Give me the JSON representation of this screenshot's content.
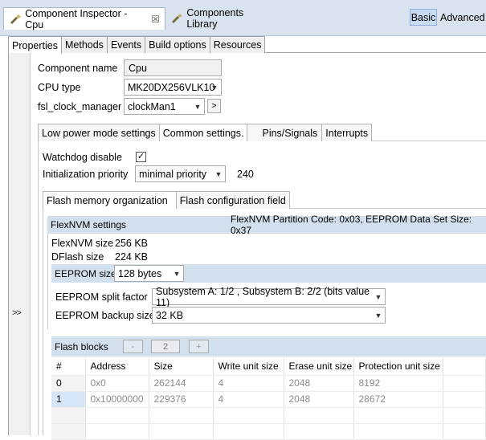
{
  "view_tabs": {
    "inspector_label": "Component Inspector - Cpu",
    "inspector_close": "☒",
    "library_label": "Components Library"
  },
  "mode": {
    "basic": "Basic",
    "advanced": "Advanced"
  },
  "main_tabs": [
    "Properties",
    "Methods",
    "Events",
    "Build options",
    "Resources"
  ],
  "collapse_label": ">>",
  "component": {
    "name_label": "Component name",
    "name_value": "Cpu",
    "cpu_type_label": "CPU type",
    "cpu_type_value": "MK20DX256VLK10",
    "clock_label": "fsl_clock_manager",
    "clock_value": "clockMan1",
    "clock_btn": ">"
  },
  "sub_tabs": [
    "Low power mode settings",
    "Common settings.",
    "Pins/Signals",
    "Interrupts"
  ],
  "common": {
    "watchdog_label": "Watchdog disable",
    "watchdog_checked": "✓",
    "init_priority_label": "Initialization priority",
    "init_priority_value": "minimal priority",
    "init_priority_number": "240"
  },
  "flash_tabs": [
    "Flash memory organization",
    "Flash configuration field"
  ],
  "flexnvm": {
    "header": "FlexNVM settings",
    "header_info": "FlexNVM Partition Code: 0x03, EEPROM Data Set Size: 0x37",
    "flexnvm_size_label": "FlexNVM size",
    "flexnvm_size_value": "256 KB",
    "dflash_size_label": "DFlash size",
    "dflash_size_value": "224 KB",
    "eeprom_size_label": "EEPROM size",
    "eeprom_size_value": "128 bytes",
    "split_label": "EEPROM split factor",
    "split_value": "Subsystem A: 1/2 , Subsystem B: 2/2 (bits value 11)",
    "backup_label": "EEPROM backup size",
    "backup_value": "32 KB"
  },
  "flash_blocks": {
    "header": "Flash blocks",
    "minus": "-",
    "count": "2",
    "plus": "+",
    "columns": [
      "#",
      "Address",
      "Size",
      "Write unit size",
      "Erase unit size",
      "Protection unit size"
    ],
    "rows": [
      [
        "0",
        "0x0",
        "262144",
        "4",
        "2048",
        "8192"
      ],
      [
        "1",
        "0x10000000",
        "229376",
        "4",
        "2048",
        "28672"
      ]
    ]
  }
}
